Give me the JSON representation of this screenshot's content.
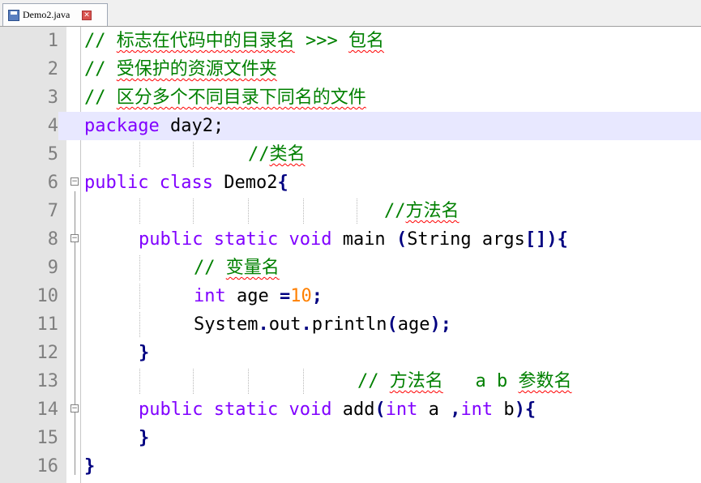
{
  "tab": {
    "filename": "Demo2.java",
    "file_icon": "save-icon",
    "close_icon": "close-icon"
  },
  "editor": {
    "current_line": 4,
    "lines": [
      {
        "n": "1",
        "text": "// 标志在代码中的目录名 >>> 包名"
      },
      {
        "n": "2",
        "text": "// 受保护的资源文件夹"
      },
      {
        "n": "3",
        "text": "// 区分多个不同目录下同名的文件"
      },
      {
        "n": "4",
        "text": "package day2;"
      },
      {
        "n": "5",
        "text": "        //类名"
      },
      {
        "n": "6",
        "text": "public class Demo2{"
      },
      {
        "n": "7",
        "text": "                    //方法名"
      },
      {
        "n": "8",
        "text": "    public static void main (String args[]){"
      },
      {
        "n": "9",
        "text": "        // 变量名"
      },
      {
        "n": "10",
        "text": "        int age =10;"
      },
      {
        "n": "11",
        "text": "        System.out.println(age);"
      },
      {
        "n": "12",
        "text": "    }"
      },
      {
        "n": "13",
        "text": "                // 方法名   a b 参数名"
      },
      {
        "n": "14",
        "text": "    public static void add(int a ,int b){"
      },
      {
        "n": "15",
        "text": "    }"
      },
      {
        "n": "16",
        "text": "}"
      }
    ]
  },
  "tokens": {
    "l1_c": "// ",
    "l1_z": "标志在代码中的目录名",
    "l1_m": " >>> ",
    "l1_z2": "包名",
    "l2_c": "// ",
    "l2_z": "受保护的资源文件夹",
    "l3_c": "// ",
    "l3_z": "区分多个不同目录下同名的文件",
    "l4_k": "package",
    "l4_r": " day2;",
    "l5_c": "//",
    "l5_z": "类名",
    "l6_k1": "public",
    "l6_s1": " ",
    "l6_k2": "class",
    "l6_r": " Demo2",
    "l6_b": "{",
    "l7_c": "//",
    "l7_z": "方法名",
    "l8_k1": "public",
    "l8_k2": "static",
    "l8_k3": "void",
    "l8_r": " main ",
    "l8_p1": "(",
    "l8_r2": "String args",
    "l8_p2": "[]){",
    "l9_c": "// ",
    "l9_z": "变量名",
    "l10_k": "int",
    "l10_r": " age ",
    "l10_o": "=",
    "l10_n": "10",
    "l10_e": ";",
    "l11_r": "System",
    "l11_o1": ".",
    "l11_r2": "out",
    "l11_o2": ".",
    "l11_r3": "println",
    "l11_o3": "(",
    "l11_r4": "age",
    "l11_o4": ");",
    "l12_b": "}",
    "l13_c": "// ",
    "l13_z": "方法名",
    "l13_m": "   a b ",
    "l13_z2": "参数名",
    "l14_k1": "public",
    "l14_k2": "static",
    "l14_k3": "void",
    "l14_r": " add",
    "l14_p1": "(",
    "l14_k4": "int",
    "l14_r2": " a ",
    "l14_p2": ",",
    "l14_k5": "int",
    "l14_r3": " b",
    "l14_p3": "){",
    "l15_b": "}",
    "l16_b": "}"
  },
  "colors": {
    "comment": "#008000",
    "keyword": "#8000ff",
    "number": "#ff8000",
    "operator": "#000080",
    "current_line_bg": "#e8e8ff",
    "gutter_bg": "#e4e4e4"
  }
}
